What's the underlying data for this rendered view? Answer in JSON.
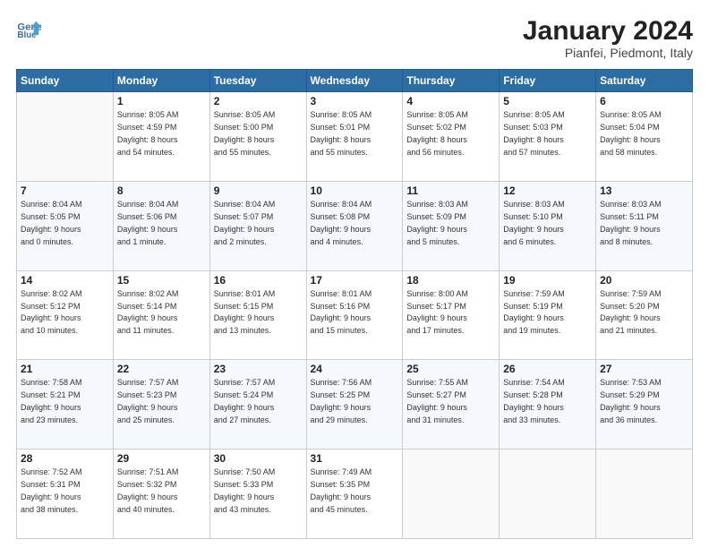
{
  "header": {
    "logo_line1": "General",
    "logo_line2": "Blue",
    "main_title": "January 2024",
    "subtitle": "Pianfei, Piedmont, Italy"
  },
  "weekdays": [
    "Sunday",
    "Monday",
    "Tuesday",
    "Wednesday",
    "Thursday",
    "Friday",
    "Saturday"
  ],
  "weeks": [
    [
      {
        "day": "",
        "info": ""
      },
      {
        "day": "1",
        "info": "Sunrise: 8:05 AM\nSunset: 4:59 PM\nDaylight: 8 hours\nand 54 minutes."
      },
      {
        "day": "2",
        "info": "Sunrise: 8:05 AM\nSunset: 5:00 PM\nDaylight: 8 hours\nand 55 minutes."
      },
      {
        "day": "3",
        "info": "Sunrise: 8:05 AM\nSunset: 5:01 PM\nDaylight: 8 hours\nand 55 minutes."
      },
      {
        "day": "4",
        "info": "Sunrise: 8:05 AM\nSunset: 5:02 PM\nDaylight: 8 hours\nand 56 minutes."
      },
      {
        "day": "5",
        "info": "Sunrise: 8:05 AM\nSunset: 5:03 PM\nDaylight: 8 hours\nand 57 minutes."
      },
      {
        "day": "6",
        "info": "Sunrise: 8:05 AM\nSunset: 5:04 PM\nDaylight: 8 hours\nand 58 minutes."
      }
    ],
    [
      {
        "day": "7",
        "info": "Sunrise: 8:04 AM\nSunset: 5:05 PM\nDaylight: 9 hours\nand 0 minutes."
      },
      {
        "day": "8",
        "info": "Sunrise: 8:04 AM\nSunset: 5:06 PM\nDaylight: 9 hours\nand 1 minute."
      },
      {
        "day": "9",
        "info": "Sunrise: 8:04 AM\nSunset: 5:07 PM\nDaylight: 9 hours\nand 2 minutes."
      },
      {
        "day": "10",
        "info": "Sunrise: 8:04 AM\nSunset: 5:08 PM\nDaylight: 9 hours\nand 4 minutes."
      },
      {
        "day": "11",
        "info": "Sunrise: 8:03 AM\nSunset: 5:09 PM\nDaylight: 9 hours\nand 5 minutes."
      },
      {
        "day": "12",
        "info": "Sunrise: 8:03 AM\nSunset: 5:10 PM\nDaylight: 9 hours\nand 6 minutes."
      },
      {
        "day": "13",
        "info": "Sunrise: 8:03 AM\nSunset: 5:11 PM\nDaylight: 9 hours\nand 8 minutes."
      }
    ],
    [
      {
        "day": "14",
        "info": "Sunrise: 8:02 AM\nSunset: 5:12 PM\nDaylight: 9 hours\nand 10 minutes."
      },
      {
        "day": "15",
        "info": "Sunrise: 8:02 AM\nSunset: 5:14 PM\nDaylight: 9 hours\nand 11 minutes."
      },
      {
        "day": "16",
        "info": "Sunrise: 8:01 AM\nSunset: 5:15 PM\nDaylight: 9 hours\nand 13 minutes."
      },
      {
        "day": "17",
        "info": "Sunrise: 8:01 AM\nSunset: 5:16 PM\nDaylight: 9 hours\nand 15 minutes."
      },
      {
        "day": "18",
        "info": "Sunrise: 8:00 AM\nSunset: 5:17 PM\nDaylight: 9 hours\nand 17 minutes."
      },
      {
        "day": "19",
        "info": "Sunrise: 7:59 AM\nSunset: 5:19 PM\nDaylight: 9 hours\nand 19 minutes."
      },
      {
        "day": "20",
        "info": "Sunrise: 7:59 AM\nSunset: 5:20 PM\nDaylight: 9 hours\nand 21 minutes."
      }
    ],
    [
      {
        "day": "21",
        "info": "Sunrise: 7:58 AM\nSunset: 5:21 PM\nDaylight: 9 hours\nand 23 minutes."
      },
      {
        "day": "22",
        "info": "Sunrise: 7:57 AM\nSunset: 5:23 PM\nDaylight: 9 hours\nand 25 minutes."
      },
      {
        "day": "23",
        "info": "Sunrise: 7:57 AM\nSunset: 5:24 PM\nDaylight: 9 hours\nand 27 minutes."
      },
      {
        "day": "24",
        "info": "Sunrise: 7:56 AM\nSunset: 5:25 PM\nDaylight: 9 hours\nand 29 minutes."
      },
      {
        "day": "25",
        "info": "Sunrise: 7:55 AM\nSunset: 5:27 PM\nDaylight: 9 hours\nand 31 minutes."
      },
      {
        "day": "26",
        "info": "Sunrise: 7:54 AM\nSunset: 5:28 PM\nDaylight: 9 hours\nand 33 minutes."
      },
      {
        "day": "27",
        "info": "Sunrise: 7:53 AM\nSunset: 5:29 PM\nDaylight: 9 hours\nand 36 minutes."
      }
    ],
    [
      {
        "day": "28",
        "info": "Sunrise: 7:52 AM\nSunset: 5:31 PM\nDaylight: 9 hours\nand 38 minutes."
      },
      {
        "day": "29",
        "info": "Sunrise: 7:51 AM\nSunset: 5:32 PM\nDaylight: 9 hours\nand 40 minutes."
      },
      {
        "day": "30",
        "info": "Sunrise: 7:50 AM\nSunset: 5:33 PM\nDaylight: 9 hours\nand 43 minutes."
      },
      {
        "day": "31",
        "info": "Sunrise: 7:49 AM\nSunset: 5:35 PM\nDaylight: 9 hours\nand 45 minutes."
      },
      {
        "day": "",
        "info": ""
      },
      {
        "day": "",
        "info": ""
      },
      {
        "day": "",
        "info": ""
      }
    ]
  ]
}
